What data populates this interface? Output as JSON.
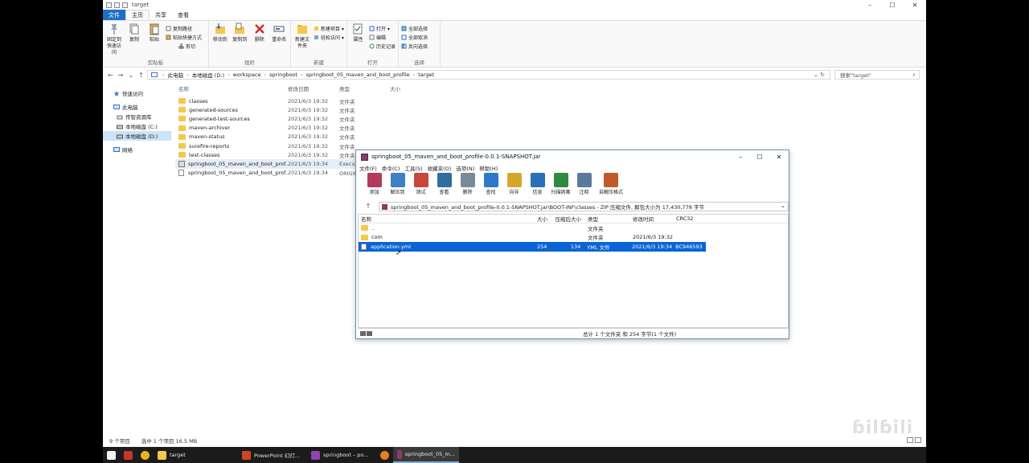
{
  "explorer": {
    "title": "target",
    "window_controls": [
      "–",
      "☐",
      "✕"
    ],
    "tabs": [
      "文件",
      "主页",
      "共享",
      "查看"
    ],
    "ribbon": {
      "clipboard": {
        "pin": "固定到快速访问",
        "copy": "复制",
        "paste": "粘贴",
        "copy_path": "复制路径",
        "paste_shortcut": "粘贴快捷方式",
        "cut": "剪切",
        "group": "剪贴板"
      },
      "organize": {
        "move_to": "移动到",
        "copy_to": "复制到",
        "delete": "删除",
        "rename": "重命名",
        "group": "组织"
      },
      "new": {
        "new_folder": "新建文件夹",
        "new_item": "新建项目 ▾",
        "easy_access": "轻松访问 ▾",
        "group": "新建"
      },
      "open": {
        "properties": "属性",
        "open": "打开 ▾",
        "edit": "编辑",
        "history": "历史记录",
        "group": "打开"
      },
      "select": {
        "select_all": "全部选择",
        "select_none": "全部取消",
        "invert": "反向选择",
        "group": "选择"
      }
    },
    "nav": {
      "back": "←",
      "forward": "→",
      "recent": "⌄",
      "up": "↑"
    },
    "breadcrumbs": [
      "此电脑",
      "本地磁盘 (D:)",
      "workspace",
      "springboot",
      "springboot_05_maven_and_boot_profile",
      "target"
    ],
    "crumb_sep": "›",
    "address_end": "⌄  ↻",
    "search_placeholder": "搜索\"target\"",
    "sidebar": [
      {
        "label": "快速访问",
        "indent": 0
      },
      {
        "label": "此电脑",
        "indent": 0
      },
      {
        "label": "传智资源库",
        "indent": 1
      },
      {
        "label": "本地磁盘 (C:)",
        "indent": 1
      },
      {
        "label": "本地磁盘 (D:)",
        "indent": 1,
        "selected": true
      },
      {
        "label": "网络",
        "indent": 0
      }
    ],
    "columns": {
      "name": "名称",
      "date": "修改日期",
      "type": "类型",
      "size": "大小"
    },
    "files": [
      {
        "name": "classes",
        "date": "2021/6/3 19:32",
        "type": "文件夹",
        "size": "",
        "kind": "folder"
      },
      {
        "name": "generated-sources",
        "date": "2021/6/3 19:32",
        "type": "文件夹",
        "size": "",
        "kind": "folder"
      },
      {
        "name": "generated-test-sources",
        "date": "2021/6/3 19:32",
        "type": "文件夹",
        "size": "",
        "kind": "folder"
      },
      {
        "name": "maven-archiver",
        "date": "2021/6/3 19:32",
        "type": "文件夹",
        "size": "",
        "kind": "folder"
      },
      {
        "name": "maven-status",
        "date": "2021/6/3 19:32",
        "type": "文件夹",
        "size": "",
        "kind": "folder"
      },
      {
        "name": "surefire-reports",
        "date": "2021/6/3 19:32",
        "type": "文件夹",
        "size": "",
        "kind": "folder"
      },
      {
        "name": "test-classes",
        "date": "2021/6/3 19:32",
        "type": "文件夹",
        "size": "",
        "kind": "folder"
      },
      {
        "name": "springboot_05_maven_and_boot_prof...",
        "date": "2021/6/3 19:34",
        "type": "Executable Jar File",
        "size": "",
        "kind": "jar",
        "selected": true
      },
      {
        "name": "springboot_05_maven_and_boot_prof...",
        "date": "2021/6/3 19:34",
        "type": "ORIGINAL 文件",
        "size": "",
        "kind": "file"
      }
    ],
    "status": {
      "count": "9 个项目",
      "selected": "选中 1 个项目  16.5 MB"
    }
  },
  "winrar": {
    "title": "springboot_05_maven_and_boot_profile-0.0.1-SNAPSHOT.jar",
    "window_controls": [
      "–",
      "☐",
      "✕"
    ],
    "menu": [
      "文件(F)",
      "命令(C)",
      "工具(S)",
      "收藏夹(O)",
      "选项(N)",
      "帮助(H)"
    ],
    "toolbar": [
      {
        "label": "添加",
        "color": "#b33a5a"
      },
      {
        "label": "解压到",
        "color": "#3f7fc4"
      },
      {
        "label": "测试",
        "color": "#c9463d"
      },
      {
        "label": "查看",
        "color": "#2f6e9e"
      },
      {
        "label": "删除",
        "color": "#7a8a96"
      },
      {
        "label": "查找",
        "color": "#2d78c8"
      },
      {
        "label": "向导",
        "color": "#d4a72c"
      },
      {
        "label": "信息",
        "color": "#2a6fb8"
      },
      {
        "label": "扫描病毒",
        "color": "#2e8b3e"
      },
      {
        "label": "注释",
        "color": "#5a7a9a"
      },
      {
        "label": "自解压格式",
        "color": "#c05a2a"
      }
    ],
    "up_arrow": "↑",
    "path": "springboot_05_maven_and_boot_profile-0.0.1-SNAPSHOT.jar\\BOOT-INF\\classes - ZIP 压缩文件, 解包大小为 17,430,778 字节",
    "dropdown": "⌄",
    "columns": {
      "name": "名称",
      "size": "大小",
      "packed": "压缩后大小",
      "type": "类型",
      "modified": "修改时间",
      "crc": "CRC32"
    },
    "rows": [
      {
        "name": "..",
        "size": "",
        "packed": "",
        "type": "文件夹",
        "modified": "",
        "crc": "",
        "kind": "folder"
      },
      {
        "name": "com",
        "size": "",
        "packed": "",
        "type": "文件夹",
        "modified": "2021/6/3 19:32",
        "crc": "",
        "kind": "folder"
      },
      {
        "name": "application.yml",
        "size": "254",
        "packed": "134",
        "type": "YML 文件",
        "modified": "2021/6/3 19:34",
        "crc": "BC946593",
        "kind": "file",
        "selected": true
      }
    ],
    "status": "总计 1 个文件夹 和 254 字节(1 个文件)"
  },
  "taskbar": {
    "items": [
      {
        "label": "",
        "color": "#f2f2f2",
        "name": "start"
      },
      {
        "label": "",
        "color": "#c0392b",
        "name": "app-red"
      },
      {
        "label": "",
        "color": "#e9b320",
        "name": "chrome"
      },
      {
        "label": "target",
        "color": "#f4c84a",
        "name": "explorer"
      },
      {
        "label": "PowerPoint 幻灯...",
        "color": "#d04423",
        "name": "powerpoint"
      },
      {
        "label": "springboot – po...",
        "color": "#8e44ad",
        "name": "idea"
      },
      {
        "label": "",
        "color": "#e67e22",
        "name": "app-orange"
      },
      {
        "label": "springboot_05_m...",
        "color": "#8a3a6a",
        "name": "winrar",
        "active": true
      }
    ]
  },
  "watermark": "bilibili"
}
